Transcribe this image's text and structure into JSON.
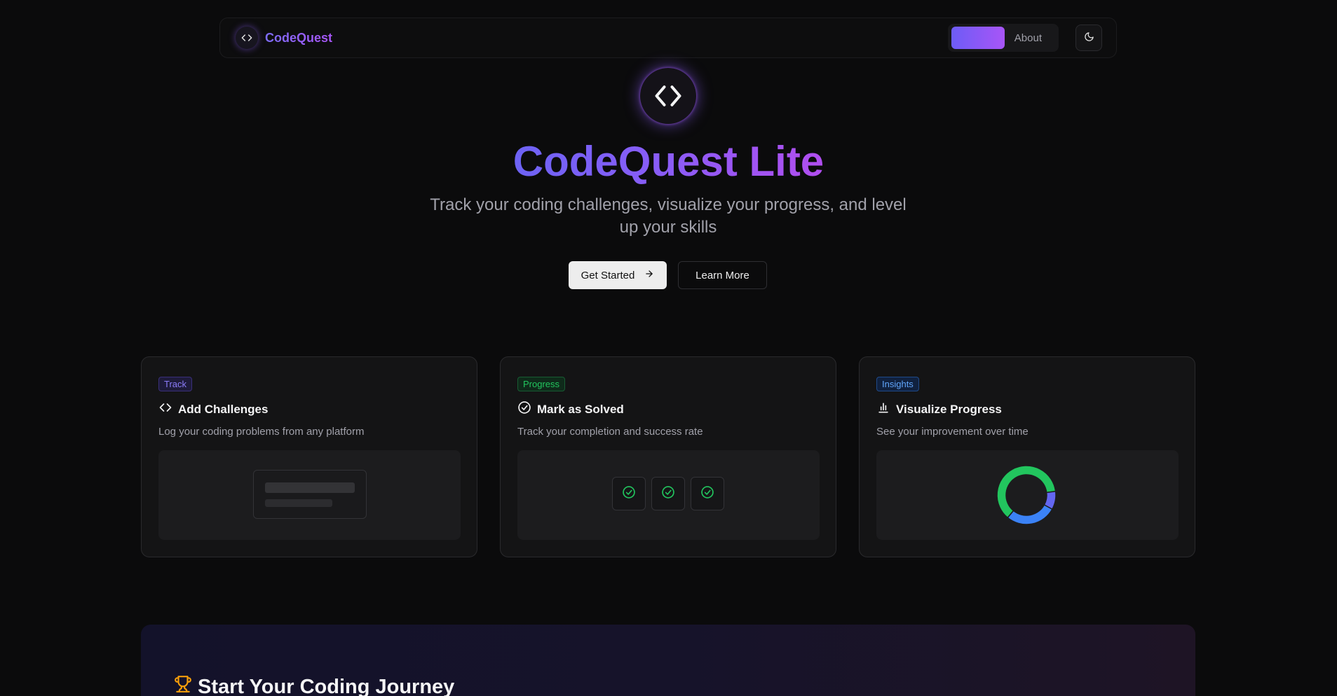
{
  "navbar": {
    "brand": "CodeQuest",
    "links": [
      {
        "label": "About"
      }
    ]
  },
  "hero": {
    "title": "CodeQuest Lite",
    "subtitle": "Track your coding challenges, visualize your progress, and level up your skills",
    "primary_button": "Get Started",
    "secondary_button": "Learn More"
  },
  "cards": [
    {
      "badge": "Track",
      "title": "Add Challenges",
      "description": "Log your coding problems from any platform",
      "icon": "code-icon"
    },
    {
      "badge": "Progress",
      "title": "Mark as Solved",
      "description": "Track your completion and success rate",
      "icon": "check-circle-icon"
    },
    {
      "badge": "Insights",
      "title": "Visualize Progress",
      "description": "See your improvement over time",
      "icon": "bar-chart-icon"
    }
  ],
  "cta": {
    "title": "Start Your Coding Journey",
    "icon": "trophy-icon"
  },
  "colors": {
    "background": "#0b0b0c",
    "accent_start": "#6d5cf6",
    "accent_end": "#a855f7",
    "green": "#22c55e",
    "blue": "#3b82f6",
    "indigo": "#6366f1"
  },
  "donut_preview": {
    "segments": [
      {
        "color": "#22c55e",
        "fraction": 0.62
      },
      {
        "color": "#6366f1",
        "fraction": 0.1
      },
      {
        "color": "#3b82f6",
        "fraction": 0.28
      }
    ]
  }
}
